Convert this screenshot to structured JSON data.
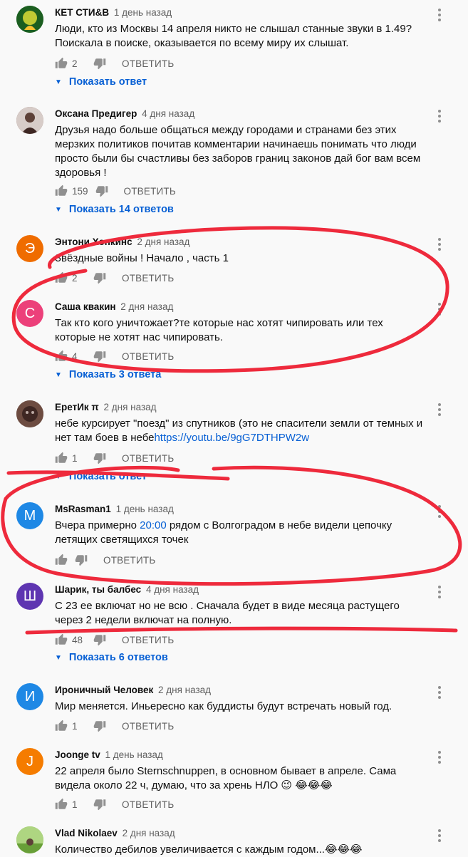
{
  "comments": [
    {
      "author": "КЕТ СТИ&В",
      "time": "1 день назад",
      "text": "Люди, кто из Москвы 14 апреля никто не слышал станные звуки в 1.49?  Поискала в поиске, оказывается по всему миру их слышат.",
      "likes": "2",
      "reply_label": "ОТВЕТИТЬ",
      "show_replies": "Показать ответ",
      "avatar_color": "#2e7d32"
    },
    {
      "author": "Оксана Предигер",
      "time": "4 дня назад",
      "text": "Друзья надо больше общаться между городами и странами без этих мерзких политиков почитав комментарии начинаешь понимать что люди просто были бы счастливы без заборов границ законов дай бог вам всем здоровья !",
      "likes": "159",
      "reply_label": "ОТВЕТИТЬ",
      "show_replies": "Показать 14 ответов",
      "avatar_color": "#8d6e63"
    },
    {
      "author": "Энтони Хопкинс",
      "time": "2 дня назад",
      "text": "Звёздные войны ! Начало , часть 1",
      "likes": "2",
      "reply_label": "ОТВЕТИТЬ",
      "avatar_letter": "Э",
      "avatar_color": "#ef6c00"
    },
    {
      "author": "Саша квакин",
      "time": "2 дня назад",
      "text": "Так кто кого уничтожает?те которые нас хотят чипировать или тех которые не хотят нас чипировать.",
      "likes": "4",
      "reply_label": "ОТВЕТИТЬ",
      "show_replies": "Показать 3 ответа",
      "avatar_letter": "С",
      "avatar_color": "#ec407a"
    },
    {
      "author": "ЕретИк π",
      "time": "2 дня назад",
      "text_before": "небе курсирует \"поезд\" из спутников (это не спасители земли от темных и нет там боев в небе",
      "link": "https://youtu.be/9gG7DTHPW2w",
      "likes": "1",
      "reply_label": "ОТВЕТИТЬ",
      "show_replies": "Показать ответ",
      "avatar_color": "#5d4037"
    },
    {
      "author": "MsRasman1",
      "time": "1 день назад",
      "text_before": "Вчера примерно ",
      "time_link": "20:00",
      "text_after": " рядом с Волгоградом в небе видели цепочку летящих светящихся точек",
      "reply_label": "ОТВЕТИТЬ",
      "avatar_letter": "M",
      "avatar_color": "#1e88e5"
    },
    {
      "author": "Шарик, ты балбес",
      "time": "4 дня назад",
      "text": "С 23 ее включат но не всю . Сначала будет в виде месяца растущего через 2 недели включат на полную.",
      "likes": "48",
      "reply_label": "ОТВЕТИТЬ",
      "show_replies": "Показать 6 ответов",
      "avatar_letter": "Ш",
      "avatar_color": "#5e35b1"
    },
    {
      "author": "Ироничный Человек",
      "time": "2 дня назад",
      "text": "Мир меняется. Иньересно как буддисты будут встречать новый год.",
      "likes": "1",
      "reply_label": "ОТВЕТИТЬ",
      "avatar_letter": "И",
      "avatar_color": "#1e88e5"
    },
    {
      "author": "Joonge tv",
      "time": "1 день назад",
      "text": "22 апреля было Sternschnuppen, в основном бывает в апреле. Сама видела около 22 ч, думаю, что за хрень НЛО 😉 😂😂😂",
      "likes": "1",
      "reply_label": "ОТВЕТИТЬ",
      "avatar_letter": "J",
      "avatar_color": "#f57c00"
    },
    {
      "author": "Vlad Nikolaev",
      "time": "2 дня назад",
      "text": "Количество дебилов увеличивается с каждым годом...😂😂😂",
      "avatar_color": "#7cb342"
    }
  ],
  "colors": {
    "link": "#065fd4",
    "annotation_red": "#ee2a3c"
  },
  "icons": [
    "thumb-up-icon",
    "thumb-down-icon",
    "more-vert-icon",
    "chevron-down-icon"
  ]
}
